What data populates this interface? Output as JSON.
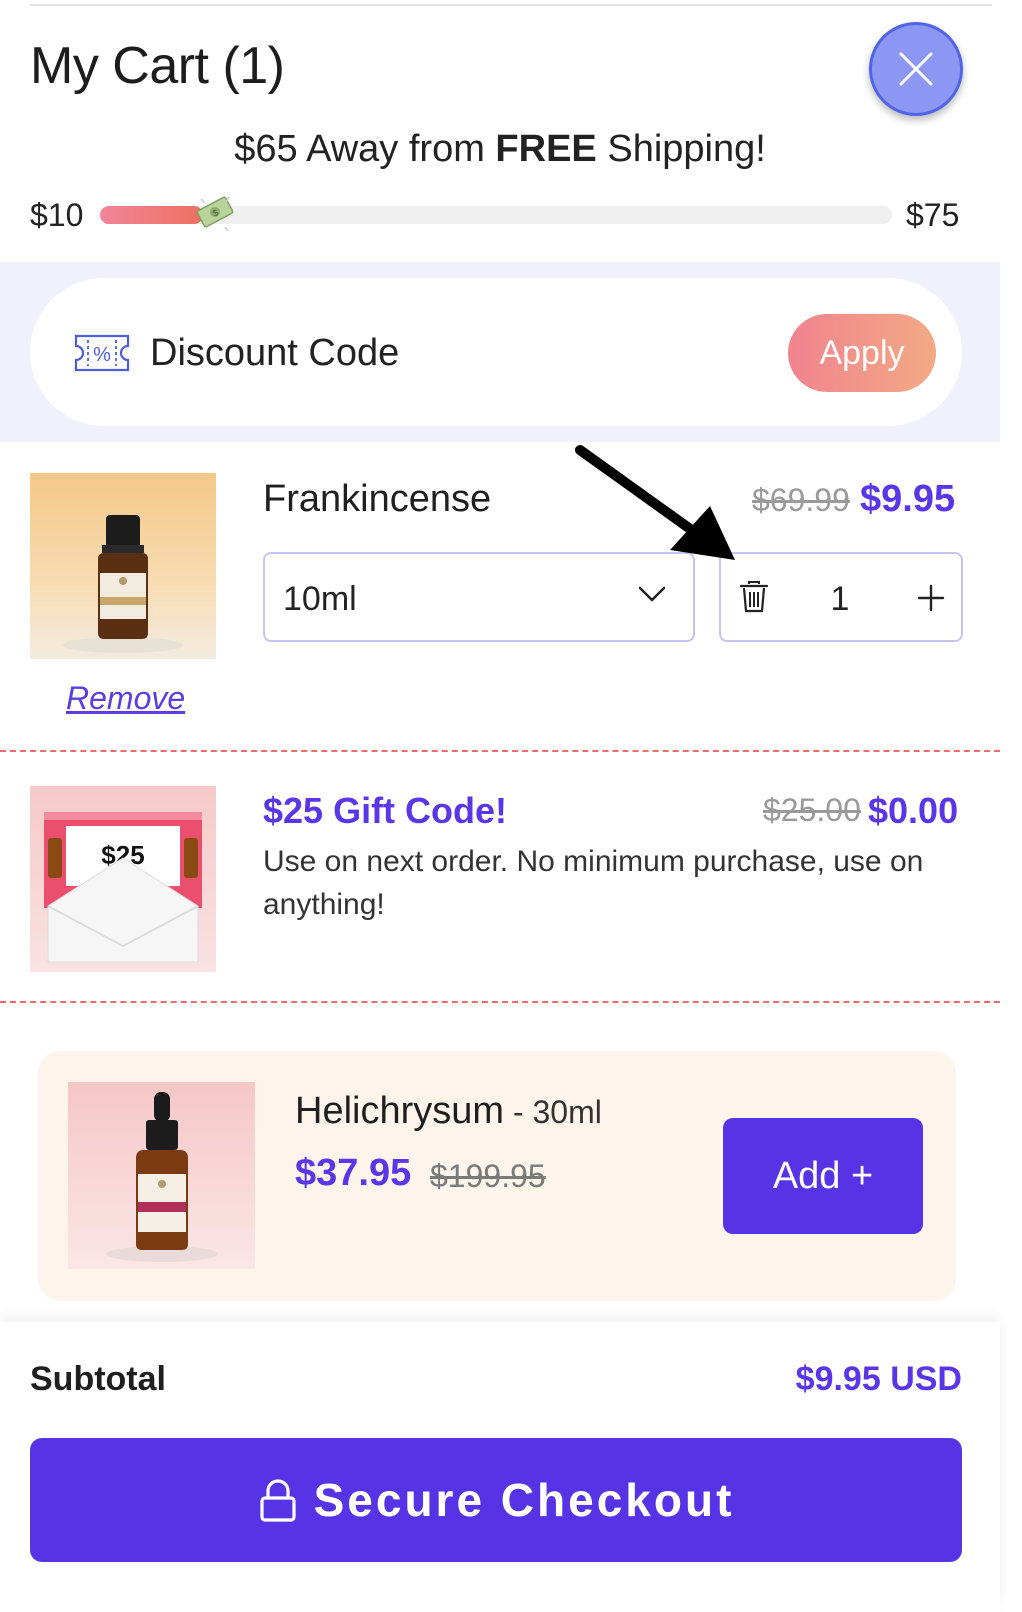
{
  "header": {
    "title": "My Cart (1)",
    "close_icon": "close-icon"
  },
  "shipping": {
    "amount": "$65",
    "middle": "Away from",
    "free": "FREE",
    "suffix": "Shipping!",
    "min_label": "$10",
    "max_label": "$75",
    "progress": 0.13
  },
  "discount": {
    "label": "Discount Code",
    "apply_label": "Apply",
    "icon": "coupon-icon"
  },
  "cart_item": {
    "name": "Frankincense",
    "old_price": "$69.99",
    "price": "$9.95",
    "variant": "10ml",
    "quantity": "1",
    "remove_label": "Remove"
  },
  "gift": {
    "title": "$25 Gift Code!",
    "old_price": "$25.00",
    "price": "$0.00",
    "description": "Use on next order. No minimum purchase, use on anything!",
    "image_amount": "$25"
  },
  "upsell": {
    "name": "Helichrysum",
    "separator": " - ",
    "variant": "30ml",
    "price": "$37.95",
    "old_price": "$199.95",
    "add_label": "Add +"
  },
  "footer": {
    "subtotal_label": "Subtotal",
    "subtotal_value": "$9.95 USD",
    "checkout_label": "Secure Checkout",
    "lock_icon": "lock-icon"
  },
  "colors": {
    "accent": "#5634e6",
    "price": "#5a36e8",
    "apply_gradient_start": "#f0838f",
    "apply_gradient_end": "#f3aa84",
    "dashed_divider": "#ef6b6b"
  }
}
